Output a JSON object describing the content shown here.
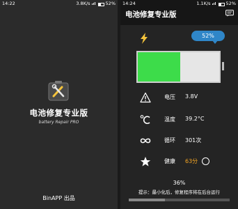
{
  "left": {
    "status": {
      "time": "14:22",
      "network": "3.8K/s",
      "battery": "52%"
    },
    "app_title": "电池修复专业版",
    "app_subtitle": "battery Repair PRO",
    "brand": "BinAPP 出品"
  },
  "right": {
    "status": {
      "time": "14:24",
      "network": "1.1K/s",
      "battery": "52%"
    },
    "title": "电池修复专业版",
    "battery_percent_label": "52%",
    "battery_level": 0.52,
    "rows": [
      {
        "icon": "warning-icon",
        "label": "电压",
        "value": "3.8V"
      },
      {
        "icon": "thermometer-icon",
        "label": "温度",
        "value": "39.2°C"
      },
      {
        "icon": "infinity-icon",
        "label": "循环",
        "value": "301次"
      },
      {
        "icon": "star-icon",
        "label": "健康",
        "value": "63分"
      }
    ],
    "progress_label": "36%",
    "progress_value": 0.36,
    "tip": "提示：最小化后，修复程序将在后台运行"
  },
  "colors": {
    "accent_blue": "#2f86c8",
    "battery_green": "#3ddc4a",
    "health_orange": "#f6a623"
  }
}
